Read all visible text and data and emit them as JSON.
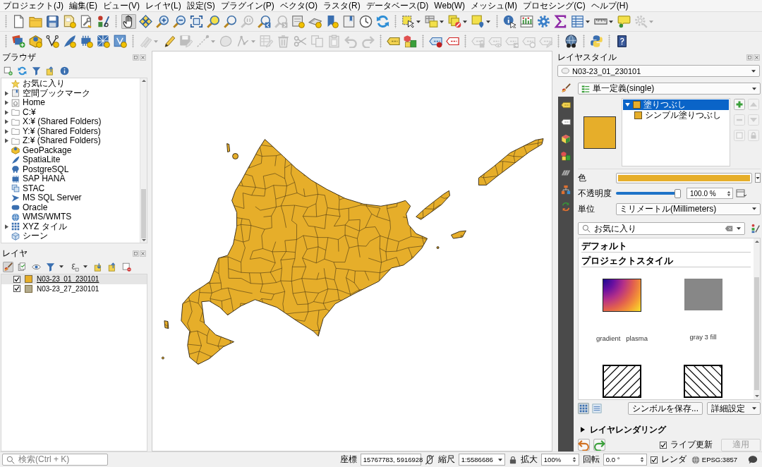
{
  "menu_bar": [
    "プロジェクト(J)",
    "編集(E)",
    "ビュー(V)",
    "レイヤ(L)",
    "設定(S)",
    "プラグイン(P)",
    "ベクタ(O)",
    "ラスタ(R)",
    "データベース(D)",
    "Web(W)",
    "メッシュ(M)",
    "プロセシング(C)",
    "ヘルプ(H)"
  ],
  "toolbars": [
    {
      "groups": [
        [
          {
            "selected": false,
            "disabled": false,
            "dropdown": false
          },
          {
            "selected": false,
            "disabled": false,
            "dropdown": false
          },
          {
            "selected": false,
            "disabled": false,
            "dropdown": false
          },
          {
            "selected": false,
            "disabled": false,
            "dropdown": false
          },
          {
            "selected": false,
            "disabled": false,
            "dropdown": false
          },
          {
            "selected": false,
            "disabled": false,
            "dropdown": false
          }
        ],
        [
          {
            "selected": true,
            "disabled": false,
            "dropdown": false
          },
          {
            "selected": false,
            "disabled": false,
            "dropdown": false
          },
          {
            "selected": false,
            "disabled": false,
            "dropdown": false
          },
          {
            "selected": false,
            "disabled": false,
            "dropdown": false
          },
          {
            "selected": false,
            "disabled": false,
            "dropdown": false
          },
          {
            "selected": false,
            "disabled": false,
            "dropdown": false
          },
          {
            "selected": false,
            "disabled": false,
            "dropdown": false
          },
          {
            "selected": false,
            "disabled": true,
            "dropdown": false
          },
          {
            "selected": false,
            "disabled": false,
            "dropdown": false
          },
          {
            "selected": false,
            "disabled": true,
            "dropdown": false
          },
          {
            "selected": false,
            "disabled": false,
            "dropdown": false
          },
          {
            "selected": false,
            "disabled": false,
            "dropdown": false
          },
          {
            "selected": false,
            "disabled": false,
            "dropdown": false
          },
          {
            "selected": false,
            "disabled": false,
            "dropdown": false
          },
          {
            "selected": false,
            "disabled": false,
            "dropdown": false
          },
          {
            "selected": false,
            "disabled": false,
            "dropdown": false
          }
        ],
        [
          {
            "selected": false,
            "disabled": false,
            "dropdown": true
          },
          {
            "selected": false,
            "disabled": false,
            "dropdown": true
          },
          {
            "selected": false,
            "disabled": false,
            "dropdown": true
          },
          {
            "selected": false,
            "disabled": false,
            "dropdown": true
          }
        ],
        [
          {
            "selected": false,
            "disabled": false,
            "dropdown": false
          },
          {
            "selected": false,
            "disabled": false,
            "dropdown": false
          },
          {
            "selected": false,
            "disabled": false,
            "dropdown": false
          },
          {
            "selected": false,
            "disabled": false,
            "dropdown": false
          },
          {
            "selected": false,
            "disabled": false,
            "dropdown": true
          },
          {
            "selected": false,
            "disabled": false,
            "dropdown": true
          },
          {
            "selected": false,
            "disabled": false,
            "dropdown": false
          },
          {
            "selected": false,
            "disabled": true,
            "dropdown": true
          }
        ]
      ]
    },
    {
      "groups": [
        [
          {
            "selected": false,
            "disabled": false,
            "dropdown": false
          },
          {
            "selected": false,
            "disabled": false,
            "dropdown": false
          },
          {
            "selected": false,
            "disabled": false,
            "dropdown": false
          },
          {
            "selected": false,
            "disabled": false,
            "dropdown": false
          },
          {
            "selected": false,
            "disabled": false,
            "dropdown": false
          },
          {
            "selected": false,
            "disabled": false,
            "dropdown": false
          },
          {
            "selected": false,
            "disabled": false,
            "dropdown": false
          }
        ],
        [
          {
            "selected": false,
            "disabled": true,
            "dropdown": true
          },
          {
            "selected": false,
            "disabled": false,
            "dropdown": false
          },
          {
            "selected": false,
            "disabled": true,
            "dropdown": false
          },
          {
            "selected": false,
            "disabled": true,
            "dropdown": true
          },
          {
            "selected": false,
            "disabled": true,
            "dropdown": false
          },
          {
            "selected": false,
            "disabled": true,
            "dropdown": true
          },
          {
            "selected": false,
            "disabled": true,
            "dropdown": false
          },
          {
            "selected": false,
            "disabled": true,
            "dropdown": false
          },
          {
            "selected": false,
            "disabled": true,
            "dropdown": false
          },
          {
            "selected": false,
            "disabled": true,
            "dropdown": false
          },
          {
            "selected": false,
            "disabled": true,
            "dropdown": false
          },
          {
            "selected": false,
            "disabled": true,
            "dropdown": false
          },
          {
            "selected": false,
            "disabled": true,
            "dropdown": false
          }
        ],
        [
          {
            "selected": false,
            "disabled": false,
            "dropdown": false
          },
          {
            "selected": false,
            "disabled": false,
            "dropdown": false
          }
        ],
        [
          {
            "selected": false,
            "disabled": false,
            "dropdown": false
          },
          {
            "selected": false,
            "disabled": false,
            "dropdown": false
          }
        ],
        [
          {
            "selected": false,
            "disabled": true,
            "dropdown": false
          },
          {
            "selected": false,
            "disabled": true,
            "dropdown": false
          },
          {
            "selected": false,
            "disabled": true,
            "dropdown": false
          },
          {
            "selected": false,
            "disabled": true,
            "dropdown": false
          },
          {
            "selected": false,
            "disabled": true,
            "dropdown": false
          }
        ],
        [
          {
            "selected": false,
            "disabled": false,
            "dropdown": false
          }
        ],
        [
          {
            "selected": false,
            "disabled": false,
            "dropdown": false
          }
        ],
        [
          {
            "selected": false,
            "disabled": false,
            "dropdown": false
          }
        ]
      ]
    }
  ],
  "browser_panel": {
    "title": "ブラウザ",
    "items": [
      {
        "label": "お気に入り",
        "expandable": false
      },
      {
        "label": "空間ブックマーク",
        "expandable": true
      },
      {
        "label": "Home",
        "expandable": true
      },
      {
        "label": "C:¥",
        "expandable": true
      },
      {
        "label": "X:¥ (Shared Folders)",
        "expandable": true
      },
      {
        "label": "Y:¥ (Shared Folders)",
        "expandable": true
      },
      {
        "label": "Z:¥ (Shared Folders)",
        "expandable": true
      },
      {
        "label": "GeoPackage",
        "expandable": false
      },
      {
        "label": "SpatiaLite",
        "expandable": false
      },
      {
        "label": "PostgreSQL",
        "expandable": false
      },
      {
        "label": "SAP HANA",
        "expandable": false
      },
      {
        "label": "STAC",
        "expandable": false
      },
      {
        "label": "MS SQL Server",
        "expandable": false
      },
      {
        "label": "Oracle",
        "expandable": false
      },
      {
        "label": "WMS/WMTS",
        "expandable": false
      },
      {
        "label": "XYZ タイル",
        "expandable": true
      },
      {
        "label": "シーン",
        "expandable": false
      }
    ]
  },
  "layers_panel": {
    "title": "レイヤ",
    "tools": [
      {
        "selected": true,
        "dropdown": false
      },
      {
        "selected": false,
        "dropdown": false
      },
      {
        "selected": false,
        "dropdown": false
      },
      {
        "selected": false,
        "dropdown": true
      },
      {
        "selected": false,
        "dropdown": true
      },
      {
        "selected": false,
        "dropdown": false
      },
      {
        "selected": false,
        "dropdown": false
      },
      {
        "selected": false,
        "dropdown": false
      }
    ],
    "layers": [
      {
        "name": "N03-23_01_230101",
        "checked": true,
        "selected": true,
        "color": "#e6ae2a"
      },
      {
        "name": "N03-23_27_230101",
        "checked": true,
        "selected": false,
        "color": "#b3ab8c"
      }
    ]
  },
  "layer_styling": {
    "title": "レイヤスタイル",
    "layer": "N03-23_01_230101",
    "tabs": [
      {
        "selected": true
      },
      {
        "selected": false
      },
      {
        "selected": false
      },
      {
        "selected": false
      },
      {
        "selected": false
      },
      {
        "selected": false
      },
      {
        "selected": false
      },
      {
        "selected": false
      }
    ],
    "renderer": "単一定義(single)",
    "symbol_layers": [
      {
        "label": "塗りつぶし",
        "selected": true,
        "expanded": true,
        "children": [
          {
            "label": "シンプル塗りつぶし",
            "selected": false
          }
        ]
      }
    ],
    "symbol_buttons": [
      {
        "disabled": false
      },
      {
        "disabled": true
      },
      {
        "disabled": true
      },
      {
        "disabled": true
      },
      {
        "disabled": true
      },
      {
        "disabled": true
      }
    ],
    "color": {
      "label": "色"
    },
    "opacity": {
      "label": "不透明度",
      "level": 1.0,
      "reading": "100.0 %"
    },
    "unit": {
      "label": "単位",
      "value": "ミリメートル(Millimeters)"
    },
    "search": {
      "value": "お気に入り"
    },
    "groups": [
      {
        "title": "デフォルト"
      },
      {
        "title": "プロジェクトスタイル",
        "symbols": [
          {
            "label": "gradient   plasma",
            "kind": "gradient"
          },
          {
            "label": "gray 3 fill",
            "kind": "solid"
          },
          {
            "kind": "slash"
          },
          {
            "kind": "backslash"
          }
        ]
      }
    ],
    "view_modes": [
      {
        "selected": true
      },
      {
        "selected": false
      }
    ],
    "save_button": "シンボルを保存...",
    "advanced_button": "詳細設定",
    "rendering": {
      "label": "レイヤレンダリング",
      "expanded": false
    },
    "live_update": {
      "label": "ライブ更新",
      "checked": true
    },
    "apply": {
      "label": "適用",
      "disabled": true
    }
  },
  "status_bar": {
    "search": {
      "placeholder": "検索(Ctrl + K)"
    },
    "coordinate": {
      "label": "座標",
      "value": "15767783, 5916928"
    },
    "scale": {
      "label": "縮尺",
      "value": "1:5586686"
    },
    "magnifier": {
      "label": "拡大",
      "value": "100%"
    },
    "rotation": {
      "label": "回転",
      "value": "0.0 °"
    },
    "render": {
      "label": "レンダ",
      "checked": true
    },
    "crs": "EPSG:3857"
  }
}
